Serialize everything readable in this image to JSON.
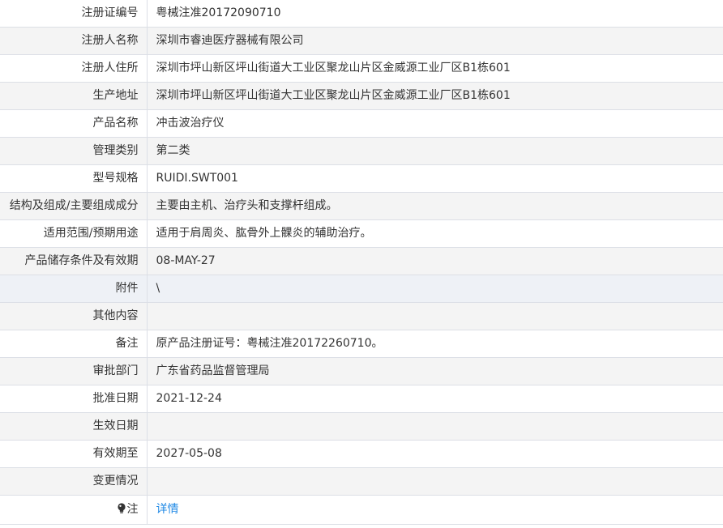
{
  "rows": [
    {
      "label": "注册证编号",
      "value": "粤械注准20172090710"
    },
    {
      "label": "注册人名称",
      "value": "深圳市睿迪医疗器械有限公司"
    },
    {
      "label": "注册人住所",
      "value": "深圳市坪山新区坪山街道大工业区聚龙山片区金威源工业厂区B1栋601"
    },
    {
      "label": "生产地址",
      "value": "深圳市坪山新区坪山街道大工业区聚龙山片区金威源工业厂区B1栋601"
    },
    {
      "label": "产品名称",
      "value": "冲击波治疗仪"
    },
    {
      "label": "管理类别",
      "value": "第二类"
    },
    {
      "label": "型号规格",
      "value": "RUIDI.SWT001"
    },
    {
      "label": "结构及组成/主要组成成分",
      "value": "主要由主机、治疗头和支撑杆组成。"
    },
    {
      "label": "适用范围/预期用途",
      "value": "适用于肩周炎、肱骨外上髁炎的辅助治疗。"
    },
    {
      "label": "产品储存条件及有效期",
      "value": "08-MAY-27"
    },
    {
      "label": "附件",
      "value": "\\"
    },
    {
      "label": "其他内容",
      "value": ""
    },
    {
      "label": "备注",
      "value": "原产品注册证号：粤械注准20172260710。"
    },
    {
      "label": "审批部门",
      "value": "广东省药品监督管理局"
    },
    {
      "label": "批准日期",
      "value": "2021-12-24"
    },
    {
      "label": "生效日期",
      "value": ""
    },
    {
      "label": "有效期至",
      "value": "2027-05-08"
    },
    {
      "label": "变更情况",
      "value": ""
    }
  ],
  "note": {
    "label": "注",
    "icon": "lightbulb-icon",
    "link_text": "详情",
    "link_color": "#1e88e5"
  }
}
